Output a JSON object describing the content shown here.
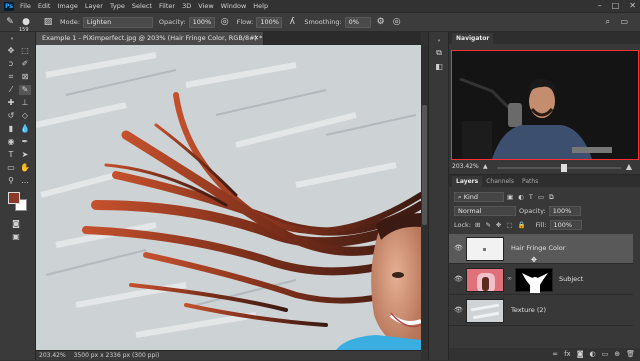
{
  "app": {
    "logo": "Ps"
  },
  "menubar": {
    "items": [
      "File",
      "Edit",
      "Image",
      "Layer",
      "Type",
      "Select",
      "Filter",
      "3D",
      "View",
      "Window",
      "Help"
    ]
  },
  "options": {
    "brush_size": "159",
    "mode_label": "Mode:",
    "mode_value": "Lighten",
    "opacity_label": "Opacity:",
    "opacity_value": "100%",
    "flow_label": "Flow:",
    "flow_value": "100%",
    "smoothing_label": "Smoothing:",
    "smoothing_value": "0%"
  },
  "document": {
    "tab_title": "Example 1 - PiXimperfect.jpg @ 203% (Hair Fringe Color, RGB/8#) *",
    "status_zoom": "203.42%",
    "status_info": "3500 px x 2336 px (300 ppi)"
  },
  "navigator": {
    "tab_label": "Navigator",
    "zoom": "203.42%"
  },
  "layers_panel": {
    "tabs": [
      "Layers",
      "Channels",
      "Paths"
    ],
    "kind_label": "Kind",
    "blend_mode": "Normal",
    "opacity_label": "Opacity:",
    "opacity_value": "100%",
    "lock_label": "Lock:",
    "fill_label": "Fill:",
    "fill_value": "100%",
    "layers": [
      {
        "name": "Hair Fringe Color",
        "selected": true
      },
      {
        "name": "Subject",
        "selected": false
      },
      {
        "name": "Texture (2)",
        "selected": false
      }
    ]
  },
  "colors": {
    "foreground": "#8a3a26",
    "background": "#ffffff",
    "accent": "#31a8ff"
  }
}
